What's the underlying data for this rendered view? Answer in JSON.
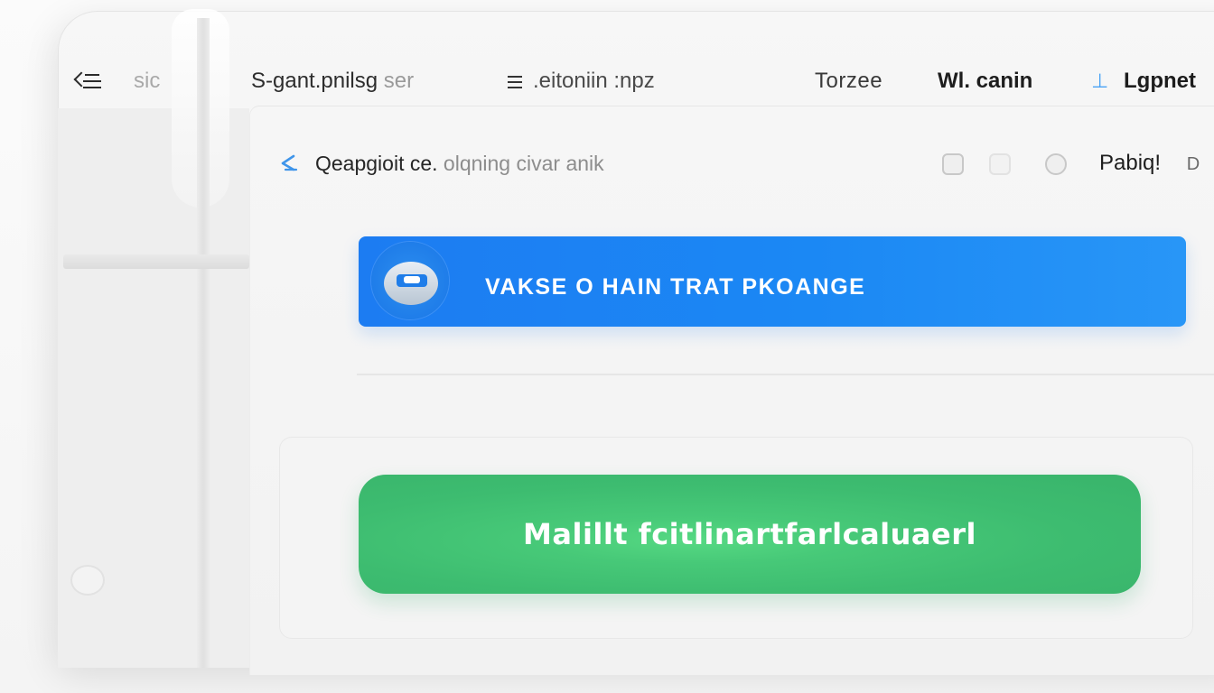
{
  "topnav": {
    "menu_icon": "menu-back-icon",
    "sig_label": "sic",
    "seg_label": "S-gant.pnilsg",
    "seg_suffix": "ser",
    "list_icon": "list-icon",
    "eit_label": ".eitoniin :npz",
    "torzee_label": "Torzee",
    "wl_label": "Wl. canin",
    "tick_label": "⊥",
    "lgpnet_label": "Lgpnet"
  },
  "panel": {
    "back_icon": "back-arrow-icon",
    "title_main": "Qeapgioit ce.",
    "title_rest": "olqning civar anik",
    "header_icons": [
      "window-icon",
      "stack-icon",
      "user-circle-icon"
    ],
    "user_label": "Pabiq!",
    "user_suffix": "D"
  },
  "banner": {
    "avatar_icon": "vr-headset-avatar-icon",
    "text": "VAKSE O HAIN TRAT PKOANGE",
    "color": "#1c7cf2"
  },
  "card": {
    "button_label": "Malillt fcitlinartfarlcaluaerl",
    "button_color": "#3dbc70"
  },
  "colors": {
    "accent_blue": "#1c7cf2",
    "accent_green": "#3dbc70",
    "tick_blue": "#4aa3f5"
  }
}
